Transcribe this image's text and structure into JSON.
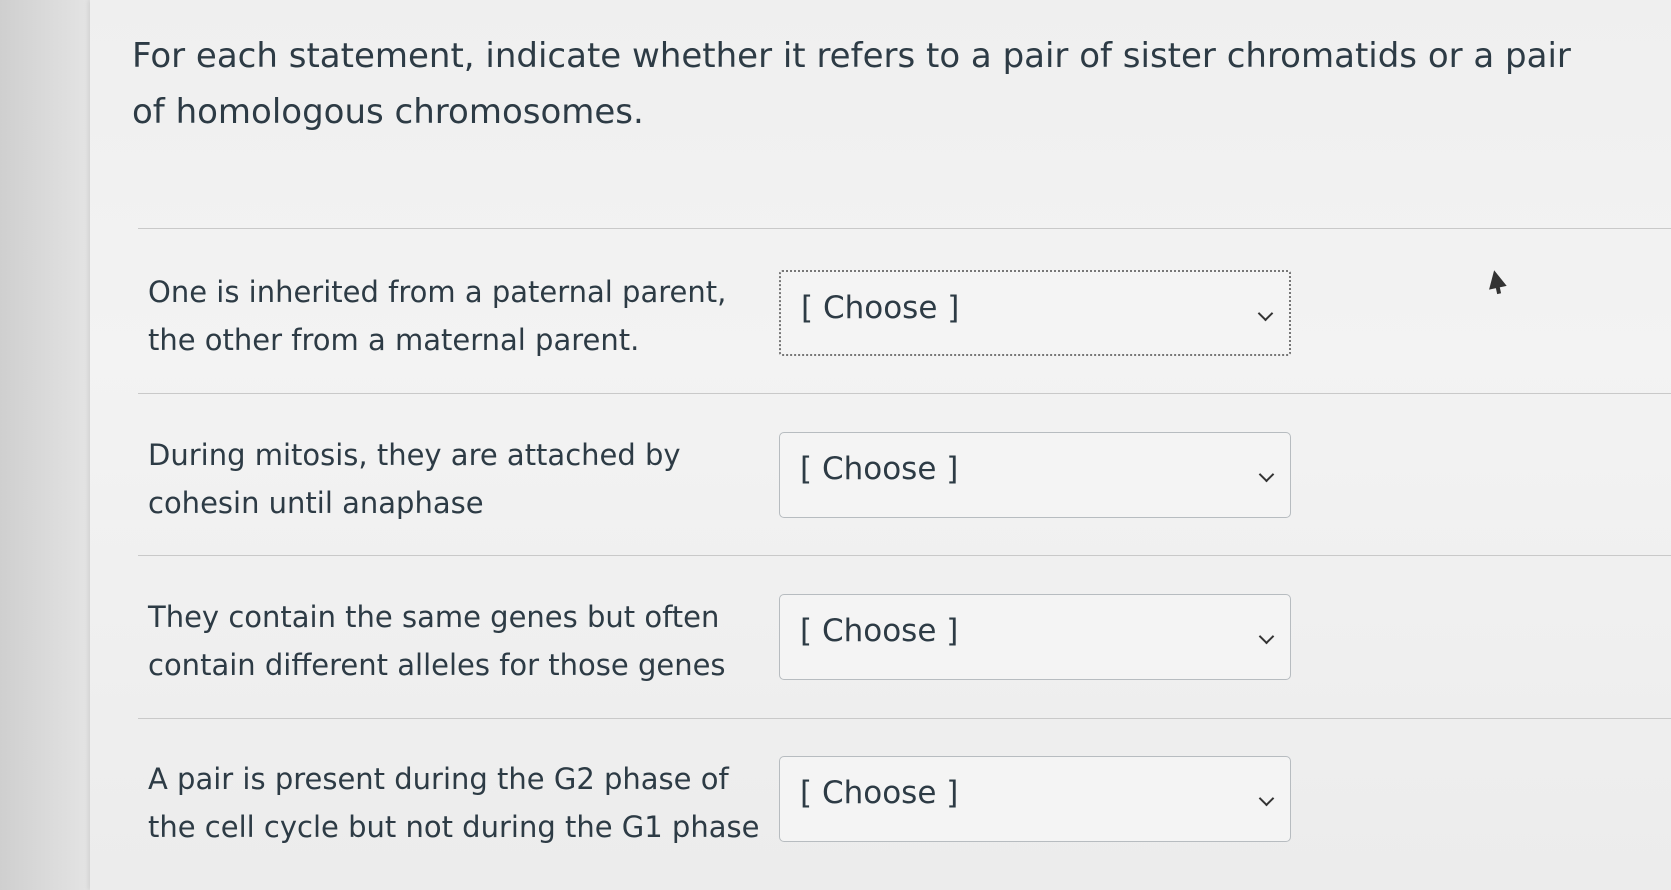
{
  "question": {
    "text": "For each statement, indicate whether it refers to a pair of sister chromatids or a pair of homologous chromosomes."
  },
  "rows": [
    {
      "statement": "One is inherited from a paternal parent, the other from a maternal parent.",
      "select_value": "[ Choose ]"
    },
    {
      "statement": "During mitosis, they are attached by cohesin until anaphase",
      "select_value": "[ Choose ]"
    },
    {
      "statement": "They contain the same genes but often contain different alleles for those genes",
      "select_value": "[ Choose ]"
    },
    {
      "statement": "A pair is present during the G2 phase of the cell cycle but not during the G1 phase",
      "select_value": "[ Choose ]"
    }
  ],
  "icons": {
    "dropdown": "chevron-down-icon",
    "pointer": "mouse-pointer-icon"
  }
}
